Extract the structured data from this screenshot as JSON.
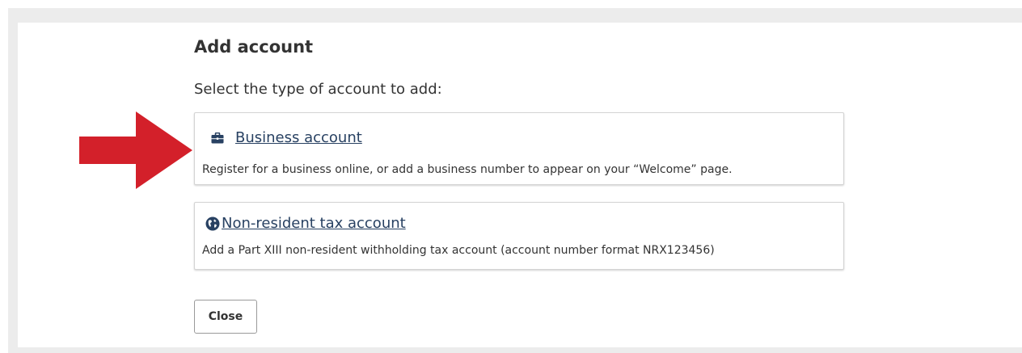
{
  "dialog": {
    "title": "Add account",
    "prompt": "Select the type of account to add:"
  },
  "options": [
    {
      "icon": "briefcase-icon",
      "label": "Business account",
      "description": "Register for a business online, or add a business number to appear on your “Welcome” page."
    },
    {
      "icon": "globe-icon",
      "label": "Non-resident tax account",
      "description": "Add a Part XIII non-resident withholding tax account (account number format NRX123456)"
    }
  ],
  "buttons": {
    "close_label": "Close"
  },
  "colors": {
    "link": "#284162",
    "arrow": "#d3202a",
    "frame": "#ececec",
    "card_border": "#d4d4d4"
  }
}
